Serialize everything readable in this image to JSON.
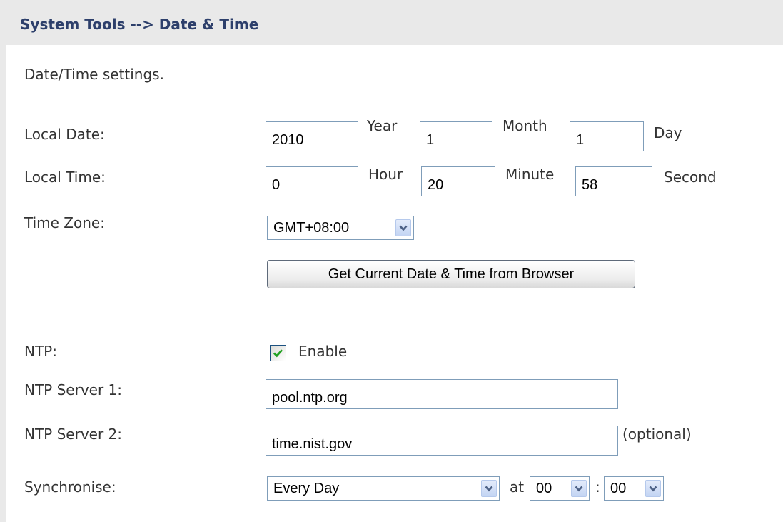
{
  "header": {
    "title": "System Tools --> Date & Time"
  },
  "description": "Date/Time settings.",
  "local_date": {
    "label": "Local Date:",
    "year_value": "2010",
    "year_unit": "Year",
    "month_value": "1",
    "month_unit": "Month",
    "day_value": "1",
    "day_unit": "Day"
  },
  "local_time": {
    "label": "Local Time:",
    "hour_value": "0",
    "hour_unit": "Hour",
    "minute_value": "20",
    "minute_unit": "Minute",
    "second_value": "58",
    "second_unit": "Second"
  },
  "time_zone": {
    "label": "Time Zone:",
    "selected": "GMT+08:00"
  },
  "get_time_button": "Get Current Date & Time from Browser",
  "ntp": {
    "label": "NTP:",
    "enable_label": "Enable",
    "enabled": true
  },
  "ntp_server_1": {
    "label": "NTP Server 1:",
    "value": "pool.ntp.org"
  },
  "ntp_server_2": {
    "label": "NTP Server 2:",
    "value": "time.nist.gov",
    "note": "(optional)"
  },
  "synchronise": {
    "label": "Synchronise:",
    "frequency": "Every Day",
    "at_label": "at",
    "hour": "00",
    "separator": ":",
    "minute": "00"
  },
  "colors": {
    "header_text": "#2d3f6b",
    "checkmark": "#21a121",
    "input_border": "#7f9db9"
  },
  "icons": {
    "dropdown": "chevron-down-icon",
    "check": "checkmark-icon"
  }
}
